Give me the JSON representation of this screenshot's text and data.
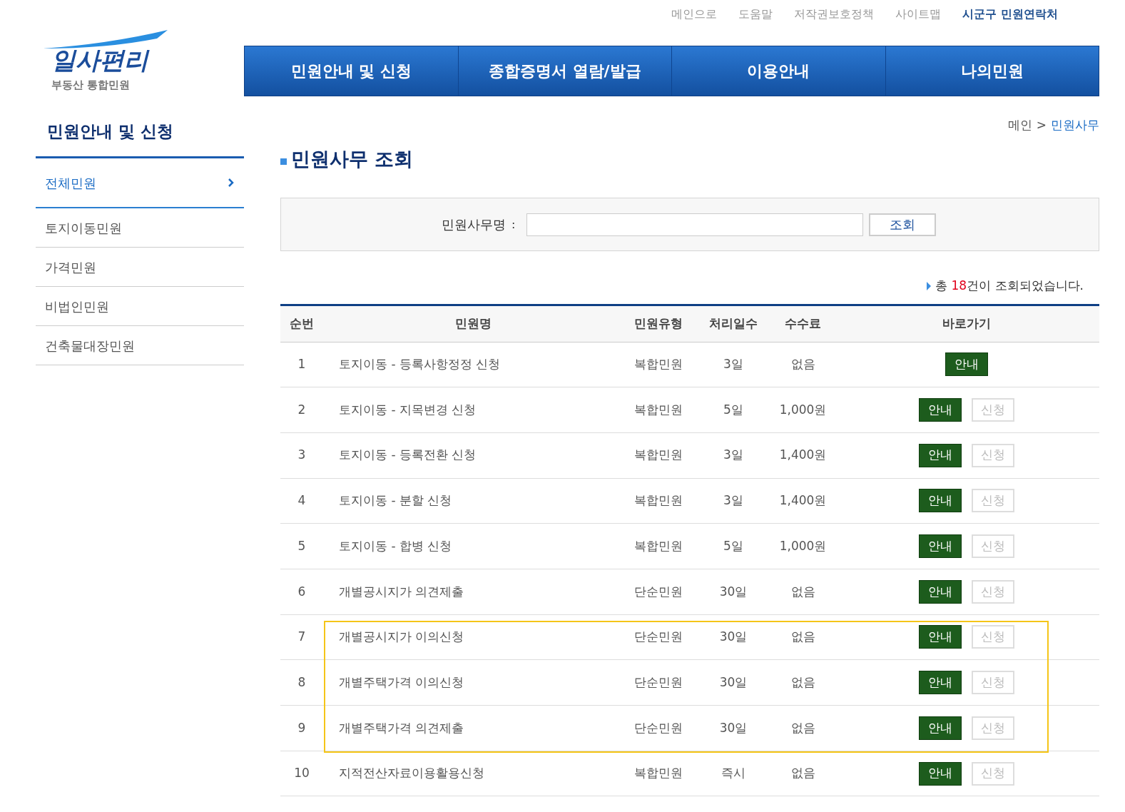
{
  "top_links": [
    {
      "label": "메인으로",
      "emphasis": false
    },
    {
      "label": "도움말",
      "emphasis": false
    },
    {
      "label": "저작권보호정책",
      "emphasis": false
    },
    {
      "label": "사이트맵",
      "emphasis": false
    },
    {
      "label": "시군구 민원연락처",
      "emphasis": true
    }
  ],
  "logo": {
    "title": "일사편리",
    "subtitle": "부동산 통합민원"
  },
  "nav": [
    "민원안내 및 신청",
    "종합증명서 열람/발급",
    "이용안내",
    "나의민원"
  ],
  "sidebar": {
    "title": "민원안내 및 신청",
    "items": [
      {
        "label": "전체민원",
        "selected": true
      },
      {
        "label": "토지이동민원",
        "selected": false
      },
      {
        "label": "가격민원",
        "selected": false
      },
      {
        "label": "비법인민원",
        "selected": false
      },
      {
        "label": "건축물대장민원",
        "selected": false
      }
    ]
  },
  "breadcrumb": [
    "메인",
    "민원사무"
  ],
  "breadcrumb_separator": ">",
  "page_title": "민원사무 조회",
  "search": {
    "label": "민원사무명",
    "colon": ":",
    "button": "조회"
  },
  "result": {
    "prefix": "총 ",
    "count": "18",
    "suffix": "건이 조회되었습니다."
  },
  "table": {
    "columns": [
      "순번",
      "민원명",
      "민원유형",
      "처리일수",
      "수수료",
      "바로가기"
    ],
    "rows": [
      {
        "no": "1",
        "name": "토지이동 - 등록사항정정 신청",
        "type": "복합민원",
        "days": "3일",
        "fee": "없음",
        "highlighted": false,
        "buttons": [
          {
            "label": "안내",
            "disabled": false
          }
        ]
      },
      {
        "no": "2",
        "name": "토지이동 - 지목변경 신청",
        "type": "복합민원",
        "days": "5일",
        "fee": "1,000원",
        "highlighted": false,
        "buttons": [
          {
            "label": "안내",
            "disabled": false
          },
          {
            "label": "신청",
            "disabled": true
          }
        ]
      },
      {
        "no": "3",
        "name": "토지이동 - 등록전환 신청",
        "type": "복합민원",
        "days": "3일",
        "fee": "1,400원",
        "highlighted": false,
        "buttons": [
          {
            "label": "안내",
            "disabled": false
          },
          {
            "label": "신청",
            "disabled": true
          }
        ]
      },
      {
        "no": "4",
        "name": "토지이동 - 분할 신청",
        "type": "복합민원",
        "days": "3일",
        "fee": "1,400원",
        "highlighted": false,
        "buttons": [
          {
            "label": "안내",
            "disabled": false
          },
          {
            "label": "신청",
            "disabled": true
          }
        ]
      },
      {
        "no": "5",
        "name": "토지이동 - 합병 신청",
        "type": "복합민원",
        "days": "5일",
        "fee": "1,000원",
        "highlighted": false,
        "buttons": [
          {
            "label": "안내",
            "disabled": false
          },
          {
            "label": "신청",
            "disabled": true
          }
        ]
      },
      {
        "no": "6",
        "name": "개별공시지가 의견제출",
        "type": "단순민원",
        "days": "30일",
        "fee": "없음",
        "highlighted": false,
        "buttons": [
          {
            "label": "안내",
            "disabled": false
          },
          {
            "label": "신청",
            "disabled": true
          }
        ]
      },
      {
        "no": "7",
        "name": "개별공시지가 이의신청",
        "type": "단순민원",
        "days": "30일",
        "fee": "없음",
        "highlighted": true,
        "buttons": [
          {
            "label": "안내",
            "disabled": false
          },
          {
            "label": "신청",
            "disabled": true
          }
        ]
      },
      {
        "no": "8",
        "name": "개별주택가격 이의신청",
        "type": "단순민원",
        "days": "30일",
        "fee": "없음",
        "highlighted": true,
        "buttons": [
          {
            "label": "안내",
            "disabled": false
          },
          {
            "label": "신청",
            "disabled": true
          }
        ]
      },
      {
        "no": "9",
        "name": "개별주택가격 의견제출",
        "type": "단순민원",
        "days": "30일",
        "fee": "없음",
        "highlighted": true,
        "buttons": [
          {
            "label": "안내",
            "disabled": false
          },
          {
            "label": "신청",
            "disabled": true
          }
        ]
      },
      {
        "no": "10",
        "name": "지적전산자료이용활용신청",
        "type": "복합민원",
        "days": "즉시",
        "fee": "없음",
        "highlighted": false,
        "buttons": [
          {
            "label": "안내",
            "disabled": false
          },
          {
            "label": "신청",
            "disabled": true
          }
        ]
      }
    ]
  }
}
